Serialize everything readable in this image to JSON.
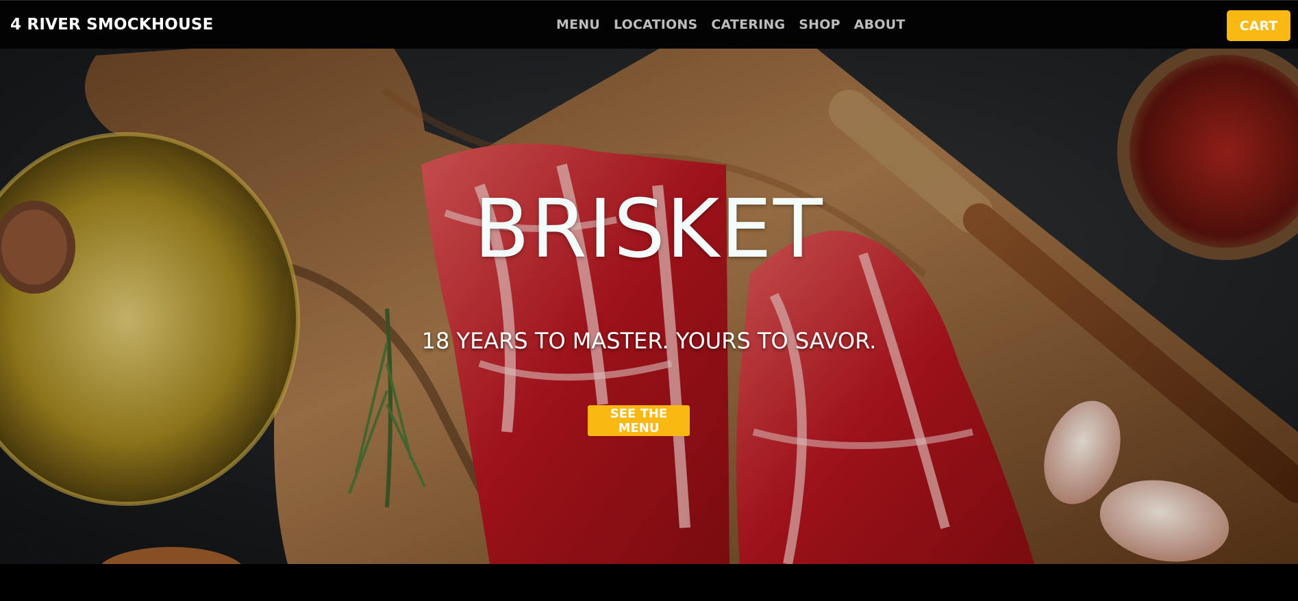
{
  "header": {
    "brand": "4 RIVER SMOCKHOUSE",
    "nav": [
      "MENU",
      "LOCATIONS",
      "CATERING",
      "SHOP",
      "ABOUT"
    ],
    "cart_label": "CART"
  },
  "hero": {
    "title": "BRISKET",
    "subtitle": "18 YEARS TO MASTER. YOURS TO SAVOR.",
    "cta_label": "SEE THE MENU"
  },
  "colors": {
    "accent": "#f9b912",
    "header_bg": "#030303",
    "nav_text": "#bdbdbd"
  }
}
